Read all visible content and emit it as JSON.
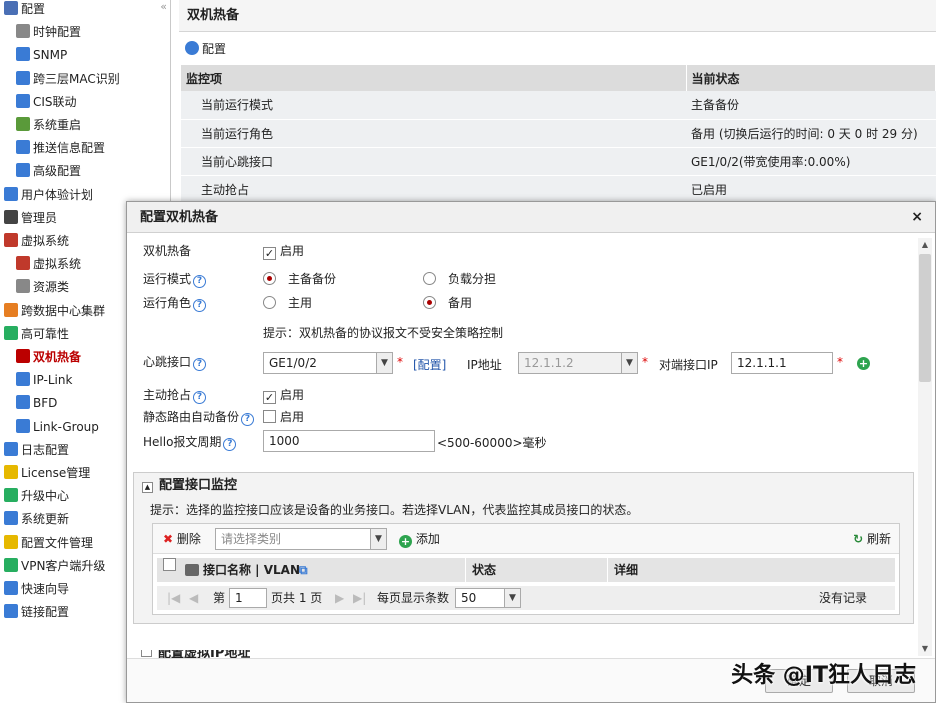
{
  "sidebar": {
    "items": [
      {
        "label": "配置",
        "icon": "config-icon",
        "color": "#4a6fb5"
      },
      {
        "label": "时钟配置",
        "icon": "clock-icon",
        "color": "#888"
      },
      {
        "label": "SNMP",
        "icon": "snmp-icon",
        "color": "#3a7bd5"
      },
      {
        "label": "跨三层MAC识别",
        "icon": "monitor-icon",
        "color": "#3a7bd5"
      },
      {
        "label": "CIS联动",
        "icon": "shield-icon",
        "color": "#3a7bd5"
      },
      {
        "label": "系统重启",
        "icon": "restart-icon",
        "color": "#5a9a3a"
      },
      {
        "label": "推送信息配置",
        "icon": "message-icon",
        "color": "#3a7bd5"
      },
      {
        "label": "高级配置",
        "icon": "advanced-icon",
        "color": "#3a7bd5"
      },
      {
        "label": "用户体验计划",
        "icon": "user-plan-icon",
        "color": "#3a7bd5"
      },
      {
        "label": "管理员",
        "icon": "admin-icon",
        "color": "#444"
      },
      {
        "label": "虚拟系统",
        "icon": "virtual-system-icon",
        "color": "#c0392b"
      },
      {
        "label": "虚拟系统",
        "icon": "virtual-system-icon",
        "color": "#c0392b"
      },
      {
        "label": "资源类",
        "icon": "resource-icon",
        "color": "#888"
      },
      {
        "label": "跨数据中心集群",
        "icon": "cluster-icon",
        "color": "#e67e22"
      },
      {
        "label": "高可靠性",
        "icon": "reliability-icon",
        "color": "#27ae60"
      },
      {
        "label": "双机热备",
        "icon": "hot-standby-icon",
        "color": "#b00"
      },
      {
        "label": "IP-Link",
        "icon": "iplink-icon",
        "color": "#3a7bd5"
      },
      {
        "label": "BFD",
        "icon": "bfd-icon",
        "color": "#3a7bd5"
      },
      {
        "label": "Link-Group",
        "icon": "linkgroup-icon",
        "color": "#3a7bd5"
      },
      {
        "label": "日志配置",
        "icon": "log-icon",
        "color": "#3a7bd5"
      },
      {
        "label": "License管理",
        "icon": "license-icon",
        "color": "#e6b800"
      },
      {
        "label": "升级中心",
        "icon": "upgrade-icon",
        "color": "#27ae60"
      },
      {
        "label": "系统更新",
        "icon": "update-icon",
        "color": "#3a7bd5"
      },
      {
        "label": "配置文件管理",
        "icon": "folder-icon",
        "color": "#e6b800"
      },
      {
        "label": "VPN客户端升级",
        "icon": "vpn-icon",
        "color": "#27ae60"
      },
      {
        "label": "快速向导",
        "icon": "wizard-icon",
        "color": "#3a7bd5"
      },
      {
        "label": "链接配置",
        "icon": "link-config-icon",
        "color": "#3a7bd5"
      }
    ],
    "collapse": "«"
  },
  "main": {
    "title": "双机热备",
    "config_label": "配置",
    "table": {
      "headers": [
        "监控项",
        "当前状态"
      ],
      "rows": [
        [
          "当前运行模式",
          "主备备份"
        ],
        [
          "当前运行角色",
          "备用 (切换后运行的时间: 0 天 0 时 29 分)"
        ],
        [
          "当前心跳接口",
          "GE1/0/2(带宽使用率:0.00%)"
        ],
        [
          "主动抢占",
          "已启用"
        ]
      ]
    }
  },
  "dialog": {
    "title": "配置双机热备",
    "close": "×",
    "hot_standby_label": "双机热备",
    "enable": "启用",
    "mode_label": "运行模式",
    "mode_opt1": "主备备份",
    "mode_opt2": "负载分担",
    "role_label": "运行角色",
    "role_opt1": "主用",
    "role_opt2": "备用",
    "tip": "提示：双机热备的协议报文不受安全策略控制",
    "heartbeat_label": "心跳接口",
    "heartbeat_value": "GE1/0/2",
    "config_link": "[配置]",
    "ip_label": "IP地址",
    "ip_value": "12.1.1.2",
    "peer_label": "对端接口IP",
    "peer_value": "12.1.1.1",
    "preempt_label": "主动抢占",
    "static_route_label": "静态路由自动备份",
    "hello_label": "Hello报文周期",
    "hello_value": "1000",
    "hello_range": "<500-60000>毫秒",
    "q": "?",
    "star": "*",
    "monitor": {
      "title": "配置接口监控",
      "hint": "提示：选择的监控接口应该是设备的业务接口。若选择VLAN，代表监控其成员接口的状态。",
      "delete": "删除",
      "select_placeholder": "请选择类别",
      "add": "添加",
      "refresh": "刷新",
      "col_name": "接口名称 | VLAN",
      "col_status": "状态",
      "col_detail": "详细",
      "page_prefix": "第",
      "page_value": "1",
      "page_total": "页共 1 页",
      "per_page": "每页显示条数",
      "per_page_value": "50",
      "no_record": "没有记录"
    },
    "next_section": "配置虚拟IP地址",
    "ok": "确定",
    "cancel": "取消"
  },
  "watermark": "头条 @IT狂人日志"
}
